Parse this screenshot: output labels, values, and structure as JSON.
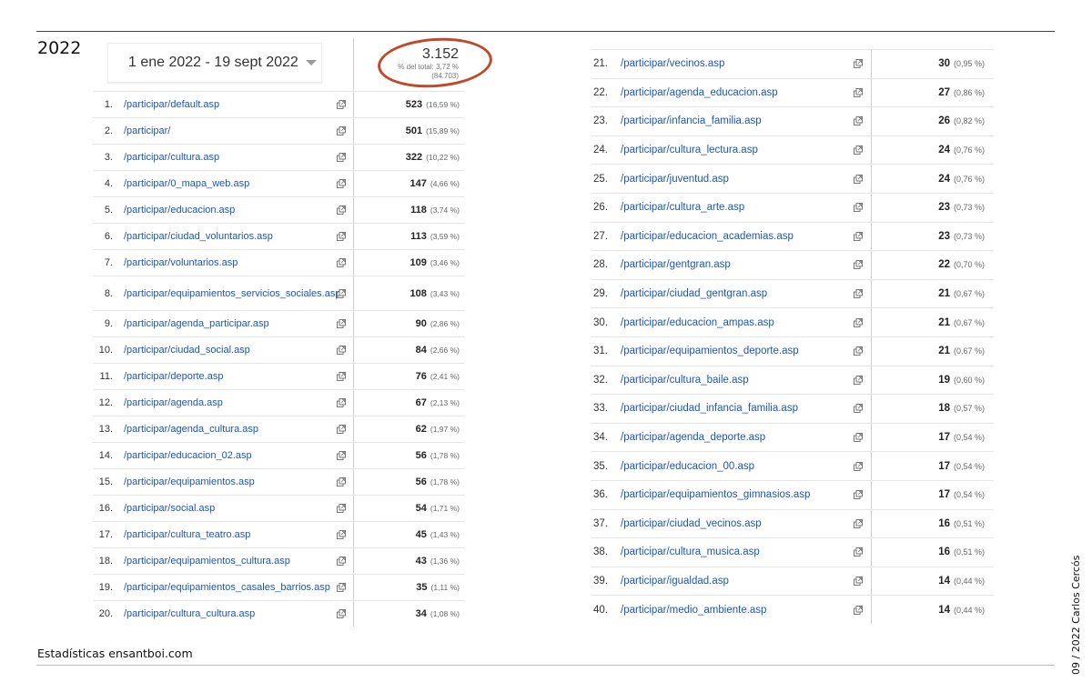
{
  "year": "2022",
  "date_range": "1 ene 2022 - 19 sept 2022",
  "total": {
    "value": "3.152",
    "subtitle": "% del total: 3,72 % (84.703)"
  },
  "footer": "Estadísticas ensantboi.com",
  "side_text": "09 / 2022  Carlos Cercós",
  "left_rows": [
    {
      "n": "1.",
      "path": "/participar/default.asp",
      "count": "523",
      "pct": "(16,59 %)"
    },
    {
      "n": "2.",
      "path": "/participar/",
      "count": "501",
      "pct": "(15,89 %)"
    },
    {
      "n": "3.",
      "path": "/participar/cultura.asp",
      "count": "322",
      "pct": "(10,22 %)"
    },
    {
      "n": "4.",
      "path": "/participar/0_mapa_web.asp",
      "count": "147",
      "pct": "(4,66 %)"
    },
    {
      "n": "5.",
      "path": "/participar/educacion.asp",
      "count": "118",
      "pct": "(3,74 %)"
    },
    {
      "n": "6.",
      "path": "/participar/ciudad_voluntarios.asp",
      "count": "113",
      "pct": "(3,59 %)"
    },
    {
      "n": "7.",
      "path": "/participar/voluntarios.asp",
      "count": "109",
      "pct": "(3,46 %)"
    },
    {
      "n": "8.",
      "path": "/participar/equipamientos_servicios_sociales.asp",
      "count": "108",
      "pct": "(3,43 %)",
      "tall": true
    },
    {
      "n": "9.",
      "path": "/participar/agenda_participar.asp",
      "count": "90",
      "pct": "(2,86 %)"
    },
    {
      "n": "10.",
      "path": "/participar/ciudad_social.asp",
      "count": "84",
      "pct": "(2,66 %)"
    },
    {
      "n": "11.",
      "path": "/participar/deporte.asp",
      "count": "76",
      "pct": "(2,41 %)"
    },
    {
      "n": "12.",
      "path": "/participar/agenda.asp",
      "count": "67",
      "pct": "(2,13 %)"
    },
    {
      "n": "13.",
      "path": "/participar/agenda_cultura.asp",
      "count": "62",
      "pct": "(1,97 %)"
    },
    {
      "n": "14.",
      "path": "/participar/educacion_02.asp",
      "count": "56",
      "pct": "(1,78 %)"
    },
    {
      "n": "15.",
      "path": "/participar/equipamientos.asp",
      "count": "56",
      "pct": "(1,78 %)"
    },
    {
      "n": "16.",
      "path": "/participar/social.asp",
      "count": "54",
      "pct": "(1,71 %)"
    },
    {
      "n": "17.",
      "path": "/participar/cultura_teatro.asp",
      "count": "45",
      "pct": "(1,43 %)"
    },
    {
      "n": "18.",
      "path": "/participar/equipamientos_cultura.asp",
      "count": "43",
      "pct": "(1,36 %)"
    },
    {
      "n": "19.",
      "path": "/participar/equipamientos_casales_barrios.asp",
      "count": "35",
      "pct": "(1,11 %)"
    },
    {
      "n": "20.",
      "path": "/participar/cultura_cultura.asp",
      "count": "34",
      "pct": "(1,08 %)"
    }
  ],
  "right_rows": [
    {
      "n": "21.",
      "path": "/participar/vecinos.asp",
      "count": "30",
      "pct": "(0,95 %)"
    },
    {
      "n": "22.",
      "path": "/participar/agenda_educacion.asp",
      "count": "27",
      "pct": "(0,86 %)"
    },
    {
      "n": "23.",
      "path": "/participar/infancia_familia.asp",
      "count": "26",
      "pct": "(0,82 %)"
    },
    {
      "n": "24.",
      "path": "/participar/cultura_lectura.asp",
      "count": "24",
      "pct": "(0,76 %)"
    },
    {
      "n": "25.",
      "path": "/participar/juventud.asp",
      "count": "24",
      "pct": "(0,76 %)"
    },
    {
      "n": "26.",
      "path": "/participar/cultura_arte.asp",
      "count": "23",
      "pct": "(0,73 %)"
    },
    {
      "n": "27.",
      "path": "/participar/educacion_academias.asp",
      "count": "23",
      "pct": "(0,73 %)"
    },
    {
      "n": "28.",
      "path": "/participar/gentgran.asp",
      "count": "22",
      "pct": "(0,70 %)"
    },
    {
      "n": "29.",
      "path": "/participar/ciudad_gentgran.asp",
      "count": "21",
      "pct": "(0,67 %)"
    },
    {
      "n": "30.",
      "path": "/participar/educacion_ampas.asp",
      "count": "21",
      "pct": "(0,67 %)"
    },
    {
      "n": "31.",
      "path": "/participar/equipamientos_deporte.asp",
      "count": "21",
      "pct": "(0,67 %)"
    },
    {
      "n": "32.",
      "path": "/participar/cultura_baile.asp",
      "count": "19",
      "pct": "(0,60 %)"
    },
    {
      "n": "33.",
      "path": "/participar/ciudad_infancia_familia.asp",
      "count": "18",
      "pct": "(0,57 %)"
    },
    {
      "n": "34.",
      "path": "/participar/agenda_deporte.asp",
      "count": "17",
      "pct": "(0,54 %)"
    },
    {
      "n": "35.",
      "path": "/participar/educacion_00.asp",
      "count": "17",
      "pct": "(0,54 %)"
    },
    {
      "n": "36.",
      "path": "/participar/equipamientos_gimnasios.asp",
      "count": "17",
      "pct": "(0,54 %)"
    },
    {
      "n": "37.",
      "path": "/participar/ciudad_vecinos.asp",
      "count": "16",
      "pct": "(0,51 %)"
    },
    {
      "n": "38.",
      "path": "/participar/cultura_musica.asp",
      "count": "16",
      "pct": "(0,51 %)"
    },
    {
      "n": "39.",
      "path": "/participar/igualdad.asp",
      "count": "14",
      "pct": "(0,44 %)"
    },
    {
      "n": "40.",
      "path": "/participar/medio_ambiente.asp",
      "count": "14",
      "pct": "(0,44 %)"
    }
  ]
}
